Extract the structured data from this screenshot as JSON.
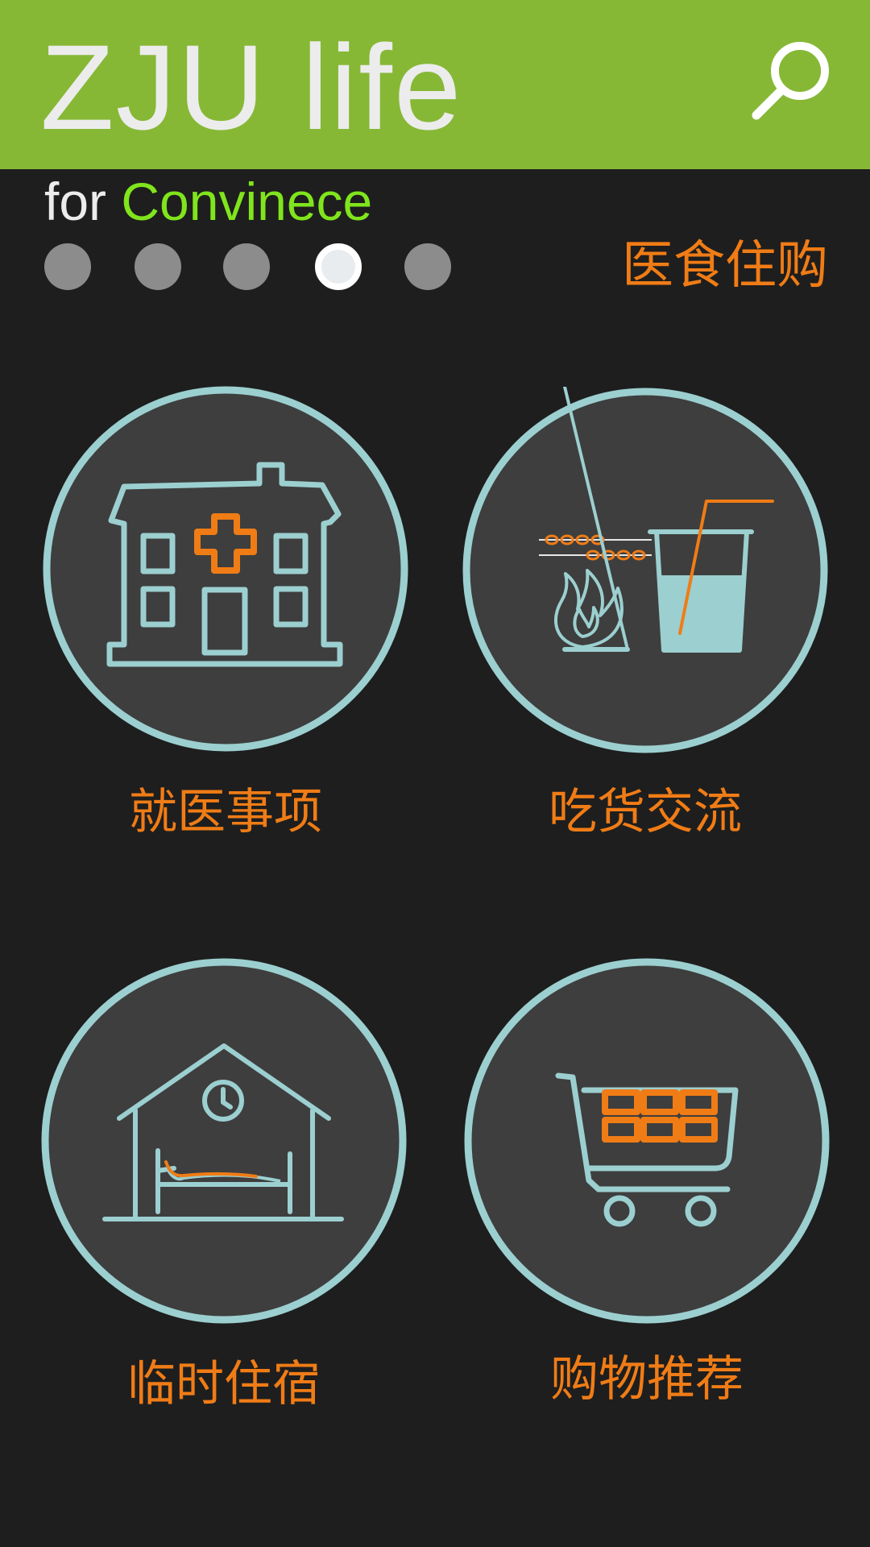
{
  "header": {
    "title": "ZJU life",
    "search_icon": "search-icon",
    "color": "#86b836"
  },
  "subtitle": {
    "prefix": "for",
    "accent": "Convinece",
    "accent_color": "#80e51c"
  },
  "pager": {
    "count": 5,
    "active_index": 3
  },
  "section_title": "医食住购",
  "tiles": [
    {
      "label": "就医事项",
      "icon": "hospital-icon"
    },
    {
      "label": "吃货交流",
      "icon": "food-drink-icon"
    },
    {
      "label": "临时住宿",
      "icon": "lodging-icon"
    },
    {
      "label": "购物推荐",
      "icon": "shopping-cart-icon"
    }
  ],
  "colors": {
    "background": "#1e1e1e",
    "circle_fill": "#3e3e3e",
    "outline": "#9ccfd0",
    "accent_orange": "#f07c16"
  }
}
